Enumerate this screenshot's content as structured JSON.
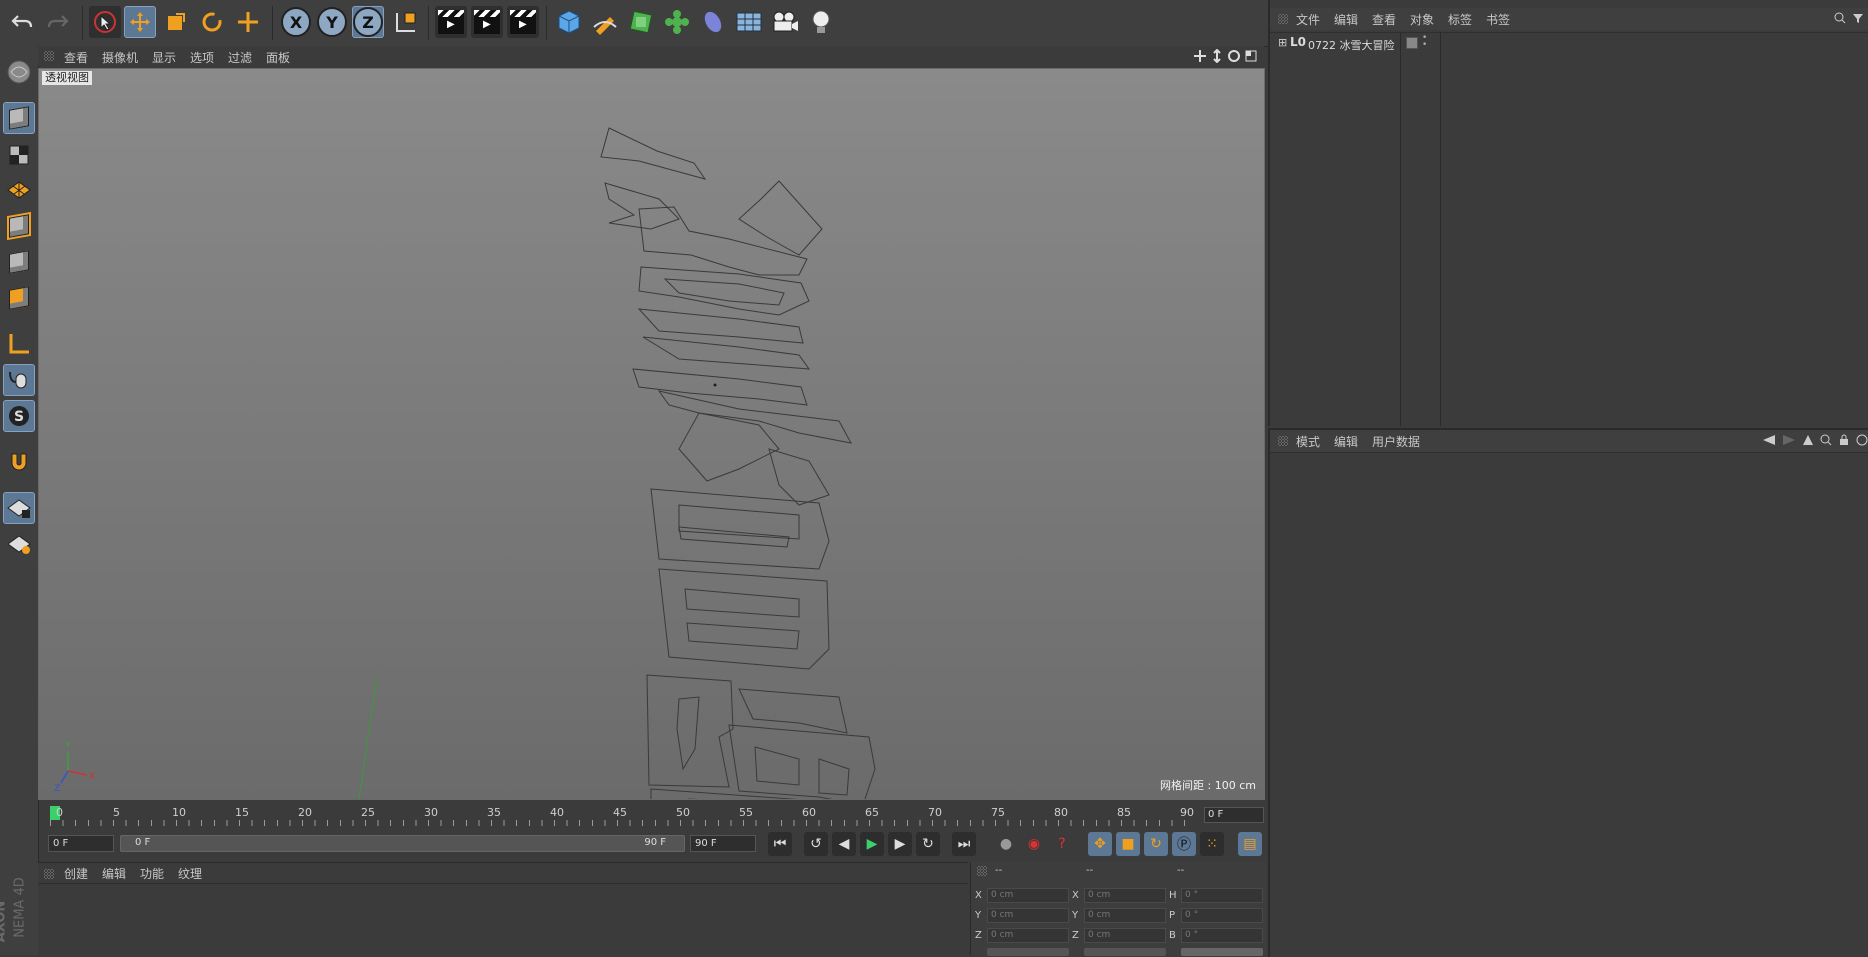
{
  "toolbar": {
    "buttons": [
      "undo-icon",
      "redo-icon",
      "select-arrow-icon",
      "move-icon",
      "scale-icon",
      "rotate-icon",
      "live-select-icon",
      "x-axis",
      "y-axis",
      "z-axis",
      "coordinate-system-icon",
      "render-view-icon",
      "render-picture-viewer-icon",
      "render-settings-icon",
      "cube-icon",
      "pen-icon",
      "subdivision-icon",
      "cloner-icon",
      "deformer-icon",
      "floor-icon",
      "camera-icon",
      "light-icon"
    ],
    "x_label": "X",
    "y_label": "Y",
    "z_label": "Z"
  },
  "viewport_menu": [
    "查看",
    "摄像机",
    "显示",
    "选项",
    "过滤",
    "面板"
  ],
  "viewport": {
    "label": "透视视图",
    "grid_info": "网格间距 : 100 cm",
    "axis_y": "Y",
    "axis_z": "Z",
    "axis_x": "X"
  },
  "timeline": {
    "ticks": [
      "0",
      "5",
      "10",
      "15",
      "20",
      "25",
      "30",
      "35",
      "40",
      "45",
      "50",
      "55",
      "60",
      "65",
      "70",
      "75",
      "80",
      "85",
      "90"
    ],
    "current_frame": "0 F"
  },
  "transport": {
    "start_field": "0 F",
    "range_start": "0 F",
    "range_end": "90 F",
    "end_field": "90 F"
  },
  "material_menu": [
    "创建",
    "编辑",
    "功能",
    "纹理"
  ],
  "coords": {
    "headers": [
      "--",
      "--",
      "--"
    ],
    "rows": [
      {
        "a": "X",
        "av": "0 cm",
        "b": "X",
        "bv": "0 cm",
        "c": "H",
        "cv": "0 °"
      },
      {
        "a": "Y",
        "av": "0 cm",
        "b": "Y",
        "bv": "0 cm",
        "c": "P",
        "cv": "0 °"
      },
      {
        "a": "Z",
        "av": "0 cm",
        "b": "Z",
        "bv": "0 cm",
        "c": "B",
        "cv": "0 °"
      }
    ]
  },
  "object_menu": [
    "文件",
    "编辑",
    "查看",
    "对象",
    "标签",
    "书签"
  ],
  "objects": [
    {
      "name": "0722 冰雪大冒险"
    }
  ],
  "attr_menu": [
    "模式",
    "编辑",
    "用户数据"
  ],
  "logo_text": "NEMA 4D",
  "logo_prefix": "AXON"
}
